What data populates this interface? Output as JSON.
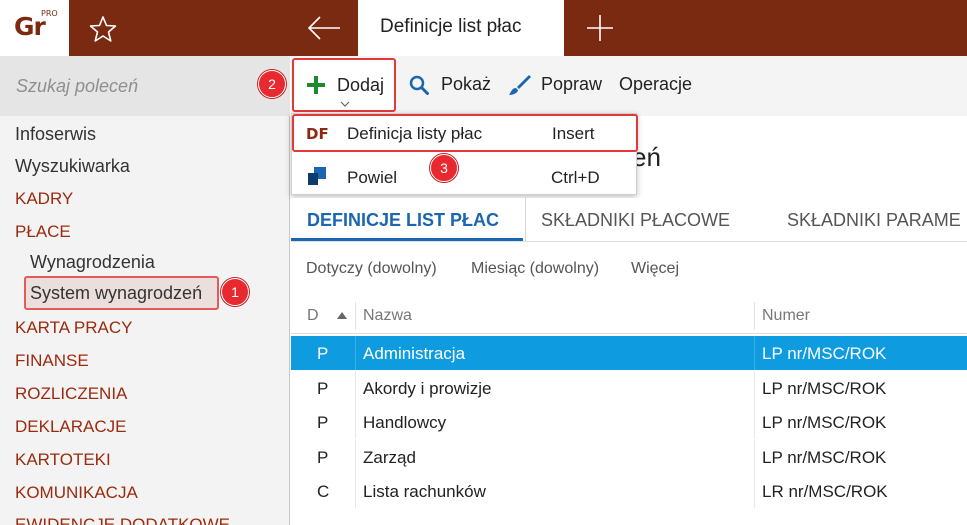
{
  "app": {
    "logo_text": "Gr",
    "logo_badge": "PRO",
    "active_tab": "Definicje list płac"
  },
  "sidebar": {
    "search_placeholder": "Szukaj poleceń",
    "items": [
      {
        "label": "Infoserwis",
        "kind": "plain"
      },
      {
        "label": "Wyszukiwarka",
        "kind": "plain"
      },
      {
        "label": "KADRY",
        "kind": "section"
      },
      {
        "label": "PŁACE",
        "kind": "section"
      },
      {
        "label": "Wynagrodzenia",
        "kind": "sub"
      },
      {
        "label": "System wynagrodzeń",
        "kind": "sub"
      },
      {
        "label": "KARTA PRACY",
        "kind": "section"
      },
      {
        "label": "FINANSE",
        "kind": "section"
      },
      {
        "label": "ROZLICZENIA",
        "kind": "section"
      },
      {
        "label": "DEKLARACJE",
        "kind": "section"
      },
      {
        "label": "KARTOTEKI",
        "kind": "section"
      },
      {
        "label": "KOMUNIKACJA",
        "kind": "section"
      },
      {
        "label": "EWIDENCJE DODATKOWE",
        "kind": "section"
      }
    ]
  },
  "badges": [
    "1",
    "2",
    "3"
  ],
  "toolbar": {
    "add": "Dodaj",
    "show": "Pokaż",
    "edit": "Popraw",
    "operations": "Operacje"
  },
  "dropdown": {
    "items": [
      {
        "icon_text": "DF",
        "label": "Definicja listy płac",
        "shortcut": "Insert"
      },
      {
        "label": "Powiel",
        "shortcut": "Ctrl+D"
      }
    ]
  },
  "page_title_tail": "eń",
  "content_tabs": [
    "DEFINICJE LIST PŁAC",
    "SKŁADNIKI PŁACOWE",
    "SKŁADNIKI PARAME"
  ],
  "filters": [
    "Dotyczy (dowolny)",
    "Miesiąc (dowolny)",
    "Więcej"
  ],
  "table": {
    "columns": [
      "D",
      "Nazwa",
      "Numer"
    ],
    "rows": [
      {
        "d": "P",
        "name": "Administracja",
        "number": "LP nr/MSC/ROK"
      },
      {
        "d": "P",
        "name": "Akordy i prowizje",
        "number": "LP nr/MSC/ROK"
      },
      {
        "d": "P",
        "name": "Handlowcy",
        "number": "LP nr/MSC/ROK"
      },
      {
        "d": "P",
        "name": "Zarząd",
        "number": "LP nr/MSC/ROK"
      },
      {
        "d": "C",
        "name": "Lista rachunków",
        "number": "LR nr/MSC/ROK"
      }
    ]
  },
  "colors": {
    "brand": "#7b2a12",
    "section_text": "#9a2b0e",
    "accent_blue": "#1b66b0",
    "selection": "#0f9be0",
    "highlight_red": "#e53838"
  },
  "icons": [
    "star-icon",
    "back-arrow-icon",
    "plus-icon",
    "add-icon",
    "search-icon",
    "brush-icon",
    "duplicate-icon",
    "sort-up-icon",
    "chevron-down-icon"
  ]
}
